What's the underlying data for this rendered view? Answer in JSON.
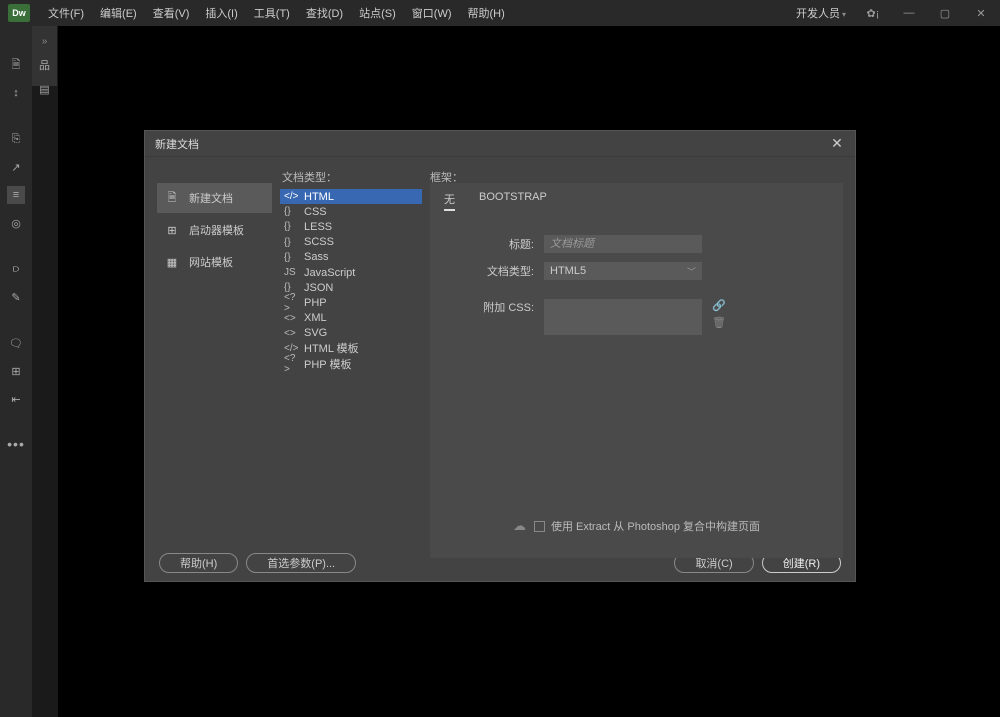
{
  "menubar": {
    "logo": "Dw",
    "items": [
      "文件(F)",
      "编辑(E)",
      "查看(V)",
      "插入(I)",
      "工具(T)",
      "查找(D)",
      "站点(S)",
      "窗口(W)",
      "帮助(H)"
    ],
    "workspace": "开发人员"
  },
  "dialog": {
    "title": "新建文档",
    "categories": [
      {
        "label": "新建文档",
        "icon": "doc"
      },
      {
        "label": "启动器模板",
        "icon": "starter"
      },
      {
        "label": "网站模板",
        "icon": "site"
      }
    ],
    "type_header": "文档类型：",
    "types": [
      {
        "label": "HTML",
        "icon": "</>"
      },
      {
        "label": "CSS",
        "icon": "{}"
      },
      {
        "label": "LESS",
        "icon": "{}"
      },
      {
        "label": "SCSS",
        "icon": "{}"
      },
      {
        "label": "Sass",
        "icon": "{}"
      },
      {
        "label": "JavaScript",
        "icon": "JS"
      },
      {
        "label": "JSON",
        "icon": "{}"
      },
      {
        "label": "PHP",
        "icon": "<?>"
      },
      {
        "label": "XML",
        "icon": "<>"
      },
      {
        "label": "SVG",
        "icon": "<>"
      },
      {
        "label": "HTML 模板",
        "icon": "</>"
      },
      {
        "label": "PHP 模板",
        "icon": "<?>"
      }
    ],
    "framework_label": "框架：",
    "framework_tabs": [
      "无",
      "BOOTSTRAP"
    ],
    "form": {
      "title_label": "标题:",
      "title_placeholder": "文档标题",
      "doctype_label": "文档类型:",
      "doctype_value": "HTML5",
      "css_label": "附加 CSS:"
    },
    "extract_text": "使用 Extract 从 Photoshop 复合中构建页面",
    "footer": {
      "help": "帮助(H)",
      "prefs": "首选参数(P)...",
      "cancel": "取消(C)",
      "create": "创建(R)"
    }
  }
}
